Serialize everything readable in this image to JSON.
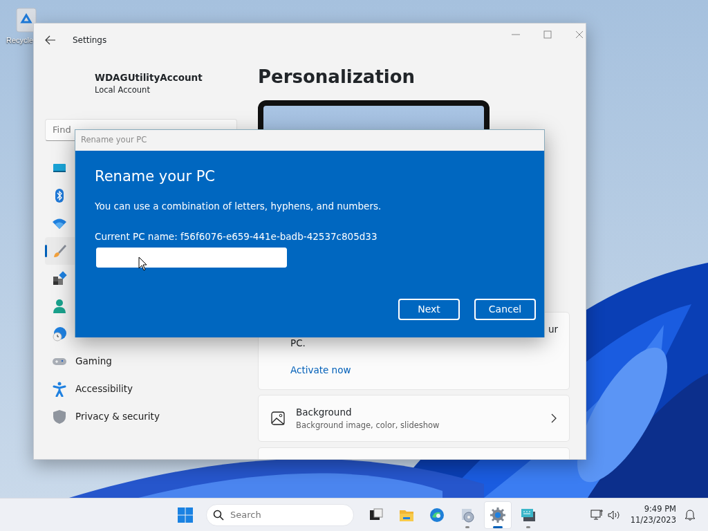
{
  "desktop": {
    "icons": [
      {
        "kind": "recycle-bin",
        "label": "Recycle"
      }
    ]
  },
  "settings_window": {
    "title": "Settings",
    "account": {
      "name": "WDAGUtilityAccount",
      "type": "Local Account"
    },
    "search": {
      "placeholder": "Find"
    },
    "sidebar": {
      "items": [
        {
          "kind": "system",
          "selected": false
        },
        {
          "kind": "bluetooth",
          "selected": false
        },
        {
          "kind": "network",
          "selected": false
        },
        {
          "kind": "personalization",
          "selected": true
        },
        {
          "kind": "apps",
          "selected": false
        },
        {
          "kind": "accounts",
          "selected": false
        },
        {
          "kind": "time",
          "selected": false
        },
        {
          "kind": "gaming",
          "label": "Gaming",
          "selected": false
        },
        {
          "kind": "accessibility",
          "label": "Accessibility",
          "selected": false
        },
        {
          "kind": "privacy",
          "label": "Privacy & security",
          "selected": false
        }
      ]
    },
    "page_title": "Personalization",
    "activation_card": {
      "line_end": "ur",
      "line_2": "PC.",
      "link": "Activate now"
    },
    "cards": [
      {
        "kind": "background",
        "title": "Background",
        "subtitle": "Background image, color, slideshow"
      }
    ]
  },
  "dialog": {
    "window_title": "Rename your PC",
    "heading": "Rename your PC",
    "description": "You can use a combination of letters, hyphens, and numbers.",
    "current_name": "Current PC name: f56f6076-e659-441e-badb-42537c805d33",
    "buttons": [
      "Next",
      "Cancel"
    ]
  },
  "taskbar": {
    "search": {
      "placeholder": "Search"
    },
    "apps": [
      {
        "kind": "task-view",
        "running": false,
        "selected": false
      },
      {
        "kind": "folder",
        "running": false,
        "selected": false
      },
      {
        "kind": "browser",
        "running": false,
        "selected": false
      },
      {
        "kind": "disc-app",
        "running": true,
        "selected": false
      },
      {
        "kind": "settings",
        "running": true,
        "selected": true
      },
      {
        "kind": "terminal",
        "running": true,
        "selected": false
      }
    ],
    "clock": {
      "time": "9:49 PM",
      "date": "11/23/2023"
    }
  }
}
